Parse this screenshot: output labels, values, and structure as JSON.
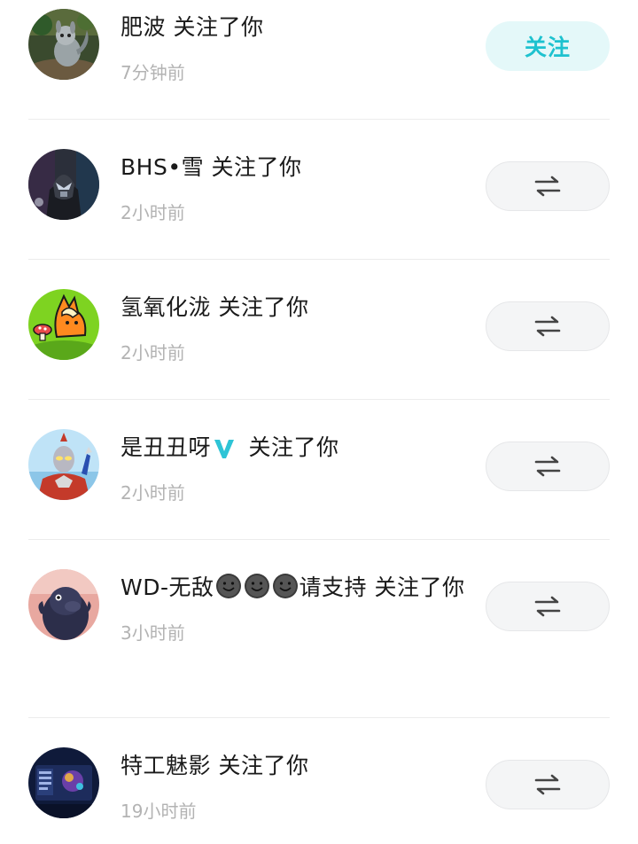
{
  "follow_label": "关注",
  "items": [
    {
      "user": "肥波",
      "action": "关注了你",
      "time": "7分钟前",
      "button": "follow-back",
      "avatar_icon": "cartoon-squirrel-avatar"
    },
    {
      "user": "BHS•雪",
      "action": "关注了你",
      "time": "2小时前",
      "button": "mutual",
      "avatar_icon": "armored-hero-avatar"
    },
    {
      "user": "氢氧化泷",
      "action": "关注了你",
      "time": "2小时前",
      "button": "mutual",
      "avatar_icon": "cartoon-fox-mushroom-avatar"
    },
    {
      "user": "是丑丑呀",
      "action": "关注了你",
      "time": "2小时前",
      "button": "mutual",
      "avatar_icon": "ultraman-avatar",
      "badge": "verified-v-icon"
    },
    {
      "user_prefix": "WD-无敌",
      "user_suffix": "请支持",
      "action": "关注了你",
      "time": "3小时前",
      "button": "mutual",
      "avatar_icon": "dark-bird-avatar",
      "emoji": "smiley-emoji-icon"
    },
    {
      "user": "特工魅影",
      "action": "关注了你",
      "time": "19小时前",
      "button": "mutual",
      "avatar_icon": "game-screen-avatar"
    }
  ],
  "colors": {
    "accent": "#1ec2cf",
    "follow_bg": "#e4f8f9",
    "mutual_bg": "#f4f5f6",
    "time_text": "#b3b3b3",
    "divider": "#ececec",
    "verified_badge": "#2ec4d6"
  }
}
